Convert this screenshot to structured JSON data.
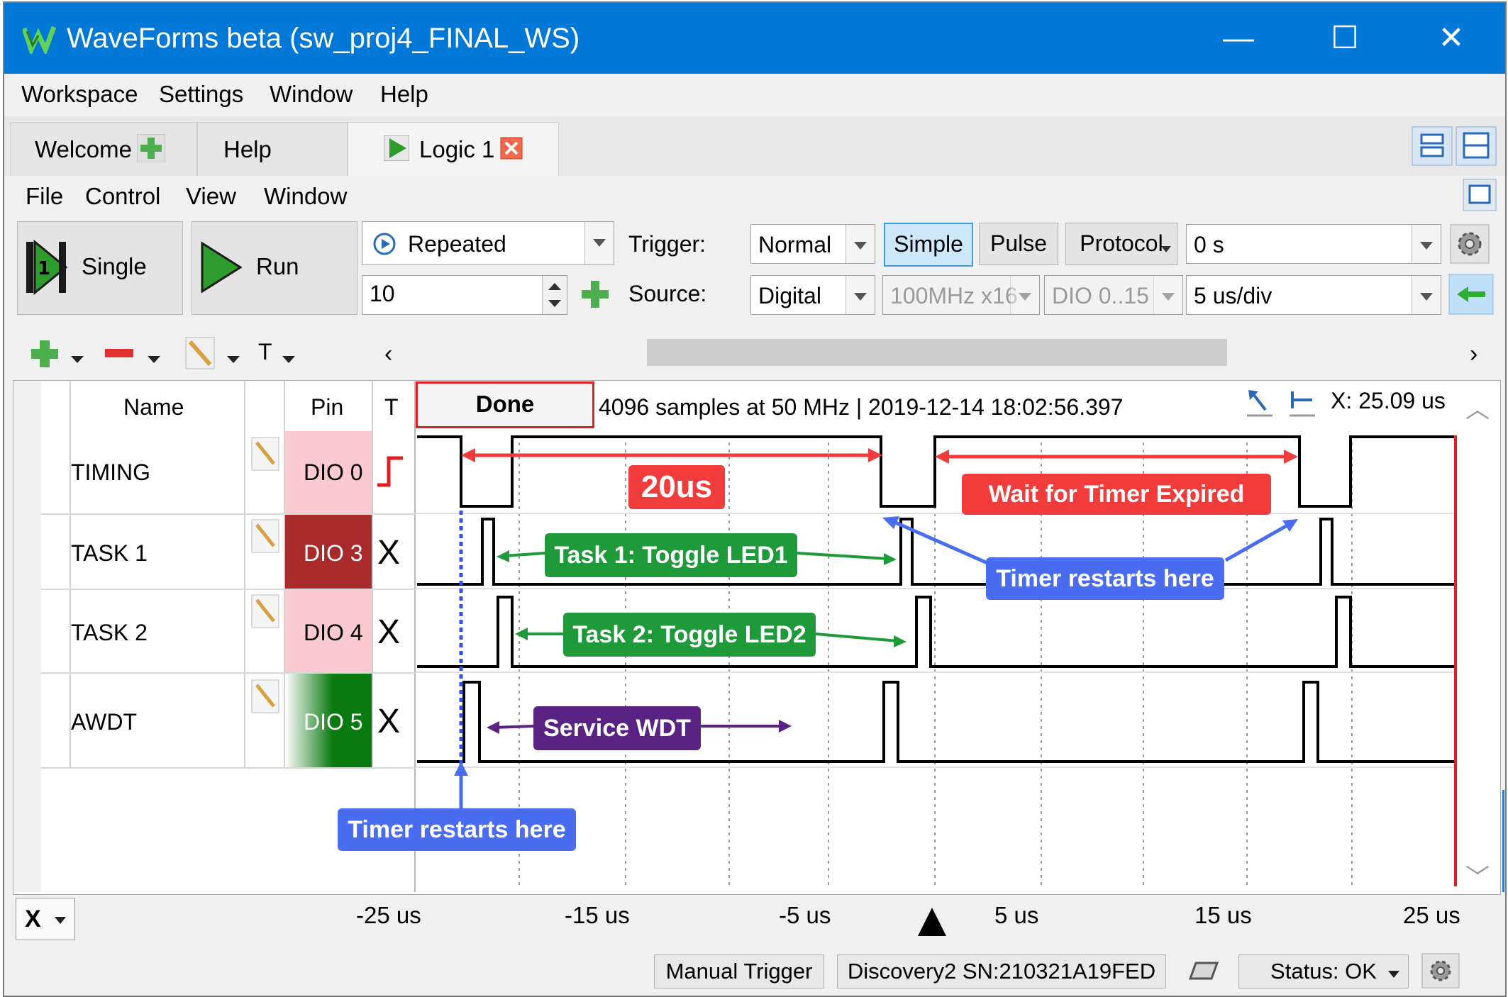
{
  "window": {
    "title": "WaveForms beta (sw_proj4_FINAL_WS)",
    "min": "—",
    "max": "☐",
    "close": "✕"
  },
  "menubar": [
    "Workspace",
    "Settings",
    "Window",
    "Help"
  ],
  "tabs": [
    {
      "label": "Welcome"
    },
    {
      "label": "Help"
    },
    {
      "label": "Logic 1",
      "active": true
    }
  ],
  "submenu": [
    "File",
    "Control",
    "View",
    "Window"
  ],
  "controls": {
    "single_label": "Single",
    "run_label": "Run",
    "mode": "Repeated",
    "count": "10",
    "trigger_label": "Trigger:",
    "trigger_mode": "Normal",
    "trigger_types": [
      "Simple",
      "Pulse",
      "Protocol"
    ],
    "trigger_position": "0 s",
    "source_label": "Source:",
    "source": "Digital",
    "rate": "100MHz x16",
    "channels": "DIO 0..15",
    "timebase": "5 us/div"
  },
  "waveview": {
    "toolbar_t": "T",
    "status": "Done",
    "info": "4096 samples at 50 MHz | 2019-12-14 18:02:56.397",
    "cursor": "X: 25.09 us",
    "headers": {
      "name": "Name",
      "pin": "Pin",
      "trigger": "T"
    },
    "channels": [
      {
        "name": "TIMING",
        "pin": "DIO 0",
        "trigger": "",
        "pin_color": "#fbc9d1"
      },
      {
        "name": "TASK 1",
        "pin": "DIO 3",
        "trigger": "X",
        "pin_color": "#a82a2a"
      },
      {
        "name": "TASK 2",
        "pin": "DIO 4",
        "trigger": "X",
        "pin_color": "#fbc9d1"
      },
      {
        "name": "AWDT",
        "pin": "DIO 5",
        "trigger": "X",
        "pin_color": "#0a7a10"
      }
    ],
    "axis_selector": "X",
    "axis_labels": [
      "-25 us",
      "-15 us",
      "-5 us",
      "5 us",
      "15 us",
      "25 us"
    ]
  },
  "annotations": {
    "period": "20us",
    "wait": "Wait for Timer Expired",
    "task1": "Task 1: Toggle LED1",
    "task2": "Task 2: Toggle LED2",
    "wdt": "Service WDT",
    "restart_right": "Timer restarts here",
    "restart_bottom": "Timer restarts here"
  },
  "statusbar": {
    "manual_trigger": "Manual Trigger",
    "device": "Discovery2 SN:210321A19FED",
    "status": "Status: OK"
  },
  "colors": {
    "titlebar": "#0078d7",
    "red": "#f23b3b",
    "green": "#1e9a3a",
    "purple": "#5a2383",
    "blue": "#4a6cf0"
  }
}
